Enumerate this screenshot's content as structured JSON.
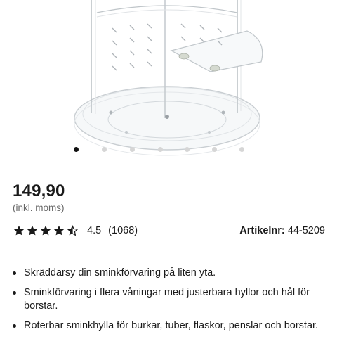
{
  "product": {
    "image_alt": "Roterbar sminkförvaring i akryl",
    "carousel": {
      "count": 8,
      "active_index": 0
    }
  },
  "price": {
    "amount": "149,90",
    "note": "(inkl. moms)"
  },
  "rating": {
    "value": "4.5",
    "count": "(1068)",
    "stars": 4.5
  },
  "article": {
    "label": "Artikelnr:",
    "number": "44-5209"
  },
  "features": [
    "Skräddarsy din sminkförvaring på liten yta.",
    "Sminkförvaring i flera våningar med justerbara hyllor och hål för borstar.",
    "Roterbar sminkhylla för burkar, tuber, flaskor, penslar och borstar."
  ],
  "colors": {
    "text": "#1a1a1a",
    "muted": "#666666",
    "star": "#1a1a1a",
    "dot_active": "#111111",
    "dot_inactive": "#d6d6d6"
  },
  "icons": {
    "rating_star": "star-icon",
    "bullet": "bullet-dot"
  }
}
